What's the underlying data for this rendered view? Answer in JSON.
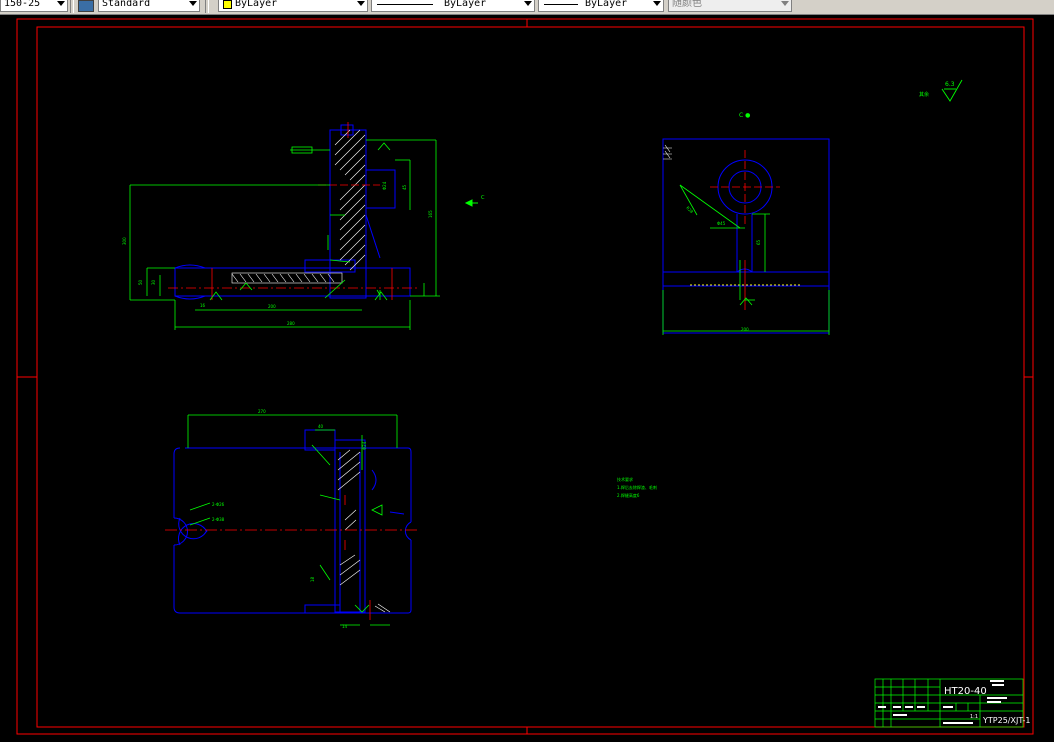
{
  "toolbar": {
    "dimstyle_value": "150-25",
    "textstyle_value": "Standard",
    "layer_color_value": "ByLayer",
    "linetype_value": "ByLayer",
    "lineweight_value": "ByLayer",
    "plotstyle_value": "随颜色",
    "colors": {
      "bylayer_swatch": "#ffff00"
    }
  },
  "drawing": {
    "section_view_label": "C ●",
    "view_direction_label": "C",
    "roughness_value": "6.3",
    "roughness_prefix": "其余",
    "notes": [
      "技术要求",
      "1.焊后去除焊渣、毛刺",
      "2.焊缝高度6"
    ],
    "title_block": {
      "drawing_name": "HT20-40",
      "drawing_number": "YTP25/XJT-1",
      "scale": "1:1"
    },
    "colors": {
      "frame": "#ff0000",
      "geometry": "#0000ff",
      "dimension": "#00ff00",
      "hatch": "#ffffff",
      "center": "#ff0000"
    }
  }
}
